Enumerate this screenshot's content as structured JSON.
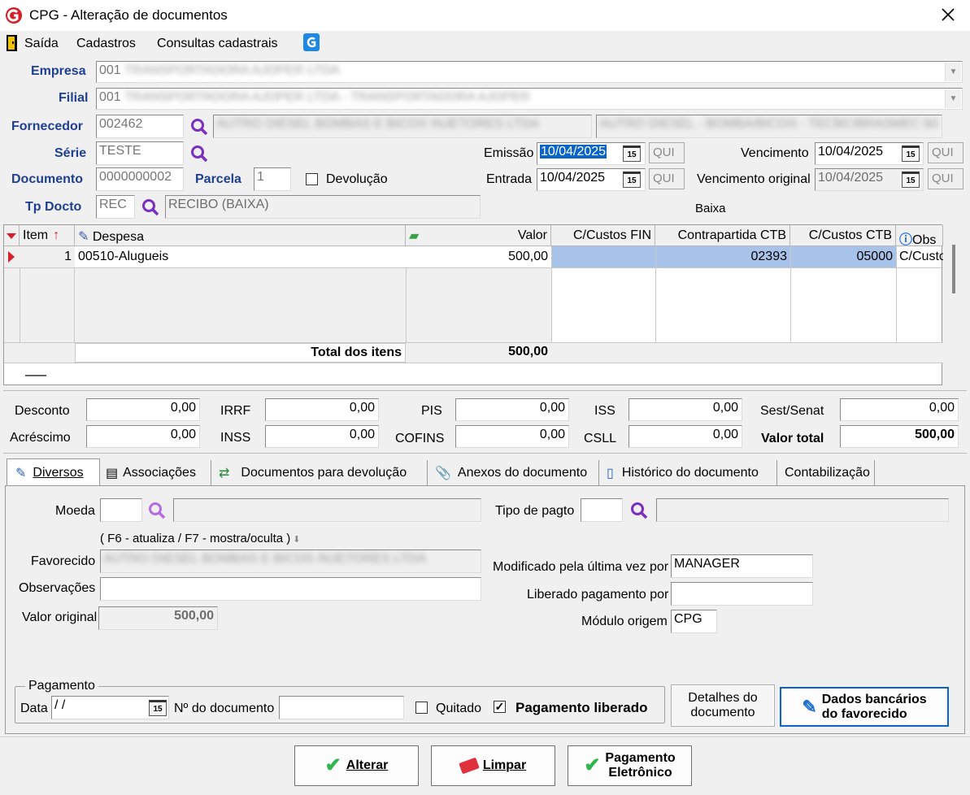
{
  "window": {
    "title": "CPG - Alteração de documentos"
  },
  "menu": {
    "items": [
      "Saída",
      "Cadastros",
      "Consultas cadastrais"
    ]
  },
  "header": {
    "empresa_label": "Empresa",
    "empresa_code": "001",
    "empresa_name": "TRANSPORTADORA AJOPER LTDA",
    "filial_label": "Filial",
    "filial_code": "001",
    "filial_name": "TRANSPORTADORA AJOPER LTDA - TRANSPORTADORA AJOPER",
    "fornecedor_label": "Fornecedor",
    "fornecedor_code": "002462",
    "fornecedor_name": "AUTRO DIESEL BOMBAS E BICOS INJETORES LTDA",
    "fornecedor_name2": "AUTRO DIESEL - BOMBA/BICOS - TECBC/BRASMEC 60",
    "serie_label": "Série",
    "serie_value": "TESTE",
    "documento_label": "Documento",
    "documento_value": "0000000002",
    "parcela_label": "Parcela",
    "parcela_value": "1",
    "devolucao_label": "Devolução",
    "tpdocto_label": "Tp Docto",
    "tpdocto_code": "REC",
    "tpdocto_name": "RECIBO (BAIXA)",
    "emissao_label": "Emissão",
    "emissao_value": "10/04/2025",
    "emissao_day": "QUI",
    "entrada_label": "Entrada",
    "entrada_value": "10/04/2025",
    "entrada_day": "QUI",
    "vencimento_label": "Vencimento",
    "vencimento_value": "10/04/2025",
    "vencimento_day": "QUI",
    "venc_original_label": "Vencimento original",
    "venc_original_value": "10/04/2025",
    "venc_original_day": "QUI",
    "baixa_label": "Baixa",
    "calendar_glyph": "15"
  },
  "grid": {
    "columns": [
      "Item",
      "Despesa",
      "Valor",
      "C/Custos FIN",
      "Contrapartida CTB",
      "C/Custos CTB",
      "Obs"
    ],
    "row": {
      "item": "1",
      "despesa": "00510-Alugueis",
      "valor": "500,00",
      "ccfin": "",
      "contrapartida": "02393",
      "ccctb": "05000",
      "obs": "C/Custo"
    },
    "total_label": "Total dos itens",
    "total_value": "500,00"
  },
  "taxes": {
    "desconto_label": "Desconto",
    "desconto": "0,00",
    "acrescimo_label": "Acréscimo",
    "acrescimo": "0,00",
    "irrf_label": "IRRF",
    "irrf": "0,00",
    "inss_label": "INSS",
    "inss": "0,00",
    "pis_label": "PIS",
    "pis": "0,00",
    "cofins_label": "COFINS",
    "cofins": "0,00",
    "iss_label": "ISS",
    "iss": "0,00",
    "csll_label": "CSLL",
    "csll": "0,00",
    "sest_label": "Sest/Senat",
    "sest": "0,00",
    "valor_total_label": "Valor total",
    "valor_total": "500,00"
  },
  "tabs": [
    "Diversos",
    "Associações",
    "Documentos para devolução",
    "Anexos do documento",
    "Histórico do documento",
    "Contabilização"
  ],
  "diversos": {
    "moeda_label": "Moeda",
    "moeda_value": "",
    "tipo_pagto_label": "Tipo de pagto",
    "tipo_pagto_value": "",
    "hint": "( F6 - atualiza / F7 - mostra/oculta )",
    "favorecido_label": "Favorecido",
    "favorecido_value": "AUTRO DIESEL BOMBAS E BICOS INJETORES LTDA",
    "observacoes_label": "Observações",
    "observacoes_value": "",
    "valor_original_label": "Valor original",
    "valor_original_value": "500,00",
    "modificado_label": "Modificado pela última vez por",
    "modificado_value": "MANAGER",
    "liberado_label": "Liberado pagamento por",
    "liberado_value": "",
    "modulo_label": "Módulo origem",
    "modulo_value": "CPG",
    "pagamento_group": "Pagamento",
    "data_label": "Data",
    "data_value": " / /",
    "ndoc_label": "Nº do documento",
    "ndoc_value": "",
    "quitado_label": "Quitado",
    "pag_liberado_label": "Pagamento liberado",
    "detalhes_btn": [
      "Detalhes do",
      "documento"
    ],
    "dados_btn": [
      "Dados bancários",
      "do favorecido"
    ]
  },
  "footer": {
    "alterar": "Alterar",
    "limpar": "Limpar",
    "pagamento_eletronico": [
      "Pagamento",
      "Eletrônico"
    ]
  },
  "colors": {
    "label_blue": "#1f3f94",
    "accent_red": "#d61f26",
    "search_purple": "#7b2fbf",
    "selection_blue": "#a8c3ea",
    "check_green": "#2eb84b"
  }
}
